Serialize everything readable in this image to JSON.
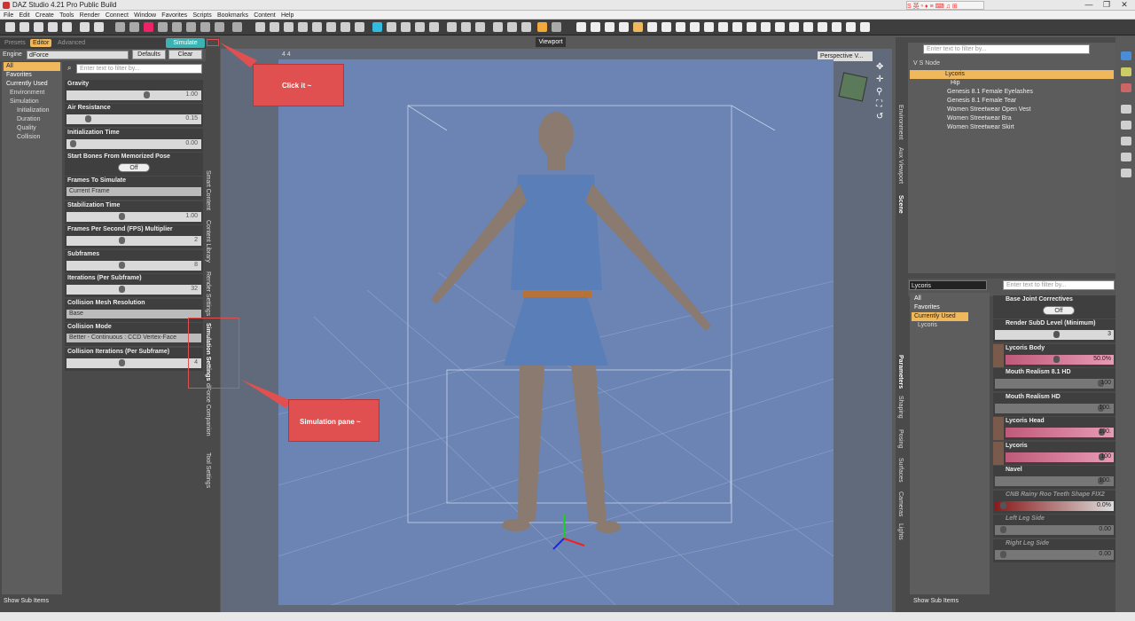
{
  "window": {
    "title": "DAZ Studio 4.21 Pro Public Build",
    "min": "—",
    "max": "❐",
    "close": "✕"
  },
  "ime": {
    "label": "S 英 ⁿ ♦ ≡ ⌨ ♫ ⊞"
  },
  "menu": [
    "File",
    "Edit",
    "Create",
    "Tools",
    "Render",
    "Connect",
    "Window",
    "Favorites",
    "Scripts",
    "Bookmarks",
    "Content",
    "Help"
  ],
  "left": {
    "tabs": [
      "Presets",
      "Editor",
      "Advanced"
    ],
    "simulate_label": "Simulate",
    "engine_label": "Engine",
    "engine_value": "dForce",
    "defaults_label": "Defaults",
    "clear_label": "Clear",
    "filter_placeholder": "Enter text to filter by...",
    "categories": [
      "All",
      "Favorites",
      "Currently Used",
      "Environment",
      "Simulation",
      "Initialization",
      "Duration",
      "Quality",
      "Collision"
    ],
    "props": [
      {
        "name": "Gravity",
        "value": "1.00",
        "knob": 0.62
      },
      {
        "name": "Air Resistance",
        "value": "0.15",
        "knob": 0.15
      },
      {
        "name": "Initialization Time",
        "value": "0.00",
        "knob": 0.03
      },
      {
        "name": "Start Bones From Memorized Pose",
        "toggle": "Off"
      },
      {
        "name": "Frames To Simulate",
        "dropdown": "Current Frame"
      },
      {
        "name": "Stabilization Time",
        "value": "1.00",
        "knob": 0.42
      },
      {
        "name": "Frames Per Second (FPS) Multiplier",
        "value": "2",
        "knob": 0.42
      },
      {
        "name": "Subframes",
        "value": "8",
        "knob": 0.42
      },
      {
        "name": "Iterations (Per Subframe)",
        "value": "32",
        "knob": 0.42
      },
      {
        "name": "Collision Mesh Resolution",
        "dropdown": "Base"
      },
      {
        "name": "Collision Mode",
        "dropdown": "Better - Continuous : CCD Vertex-Face"
      },
      {
        "name": "Collision Iterations (Per Subframe)",
        "value": "4",
        "knob": 0.42
      }
    ],
    "vertical_tabs": [
      "Smart Content",
      "Content Library",
      "Render Settings",
      "Simulation Settings",
      "dForce Companion",
      "Tool Settings"
    ],
    "show_sub_items": "Show Sub Items"
  },
  "viewport": {
    "tab": "Viewport",
    "camera": "Perspective V...",
    "corner": "4 4"
  },
  "callouts": {
    "click_it": "Click it ~",
    "simulation_pane": "Simulation pane ~"
  },
  "scene": {
    "filter_placeholder": "Enter text to filter by...",
    "header": "V  S  Node",
    "nodes": [
      "Lycoris",
      "Hip",
      "Genesis 8.1 Female Eyelashes",
      "Genesis 8.1 Female Tear",
      "Women Streetwear Open Vest",
      "Women Streetwear Bra",
      "Women Streetwear Skirt"
    ],
    "vertical_tabs": [
      "Environment",
      "Aux Viewport",
      "Scene"
    ]
  },
  "parameters": {
    "figure": "Lycoris",
    "filter_placeholder": "Enter text to filter by...",
    "categories": [
      "All",
      "Favorites",
      "Currently Used",
      "Lycoris"
    ],
    "items": [
      {
        "name": "Base Joint Correctives",
        "toggle": "Off"
      },
      {
        "name": "Render SubD Level (Minimum)",
        "value": "3",
        "knob": 0.55
      },
      {
        "name": "Lycoris Body",
        "value": "50.0%",
        "knob": 0.5,
        "style": "pink",
        "thumb": true
      },
      {
        "name": "Mouth Realism 8.1 HD",
        "value": "100",
        "knob": 0.97,
        "style": "dark"
      },
      {
        "name": "Mouth Realism HD",
        "value": "100.",
        "knob": 0.97,
        "style": "dark"
      },
      {
        "name": "Lycoris Head",
        "value": "100.",
        "knob": 0.97,
        "style": "pink",
        "thumb": true
      },
      {
        "name": "Lycoris",
        "value": "100",
        "knob": 0.97,
        "style": "pink",
        "thumb": true
      },
      {
        "name": "Navel",
        "value": "100.",
        "knob": 0.97,
        "style": "dark"
      },
      {
        "name": "CNB Rainy Roo Teeth Shape FIX2",
        "value": "0.0%",
        "knob": 0.05,
        "style": "red",
        "dim": true
      },
      {
        "name": "Left Leg Side",
        "value": "0.00",
        "knob": 0.05,
        "style": "dark",
        "dim": true
      },
      {
        "name": "Right Leg Side",
        "value": "0.00",
        "knob": 0.05,
        "style": "dark",
        "dim": true
      }
    ],
    "vertical_tabs": [
      "Parameters",
      "Shaping",
      "Posing",
      "Surfaces",
      "Cameras",
      "Lights"
    ],
    "show_sub_items": "Show Sub Items"
  },
  "colors": {
    "accent": "#f0b85c",
    "simulate": "#3bb3b3",
    "callout": "#e05050",
    "viewport_bg": "#6b84b3"
  }
}
